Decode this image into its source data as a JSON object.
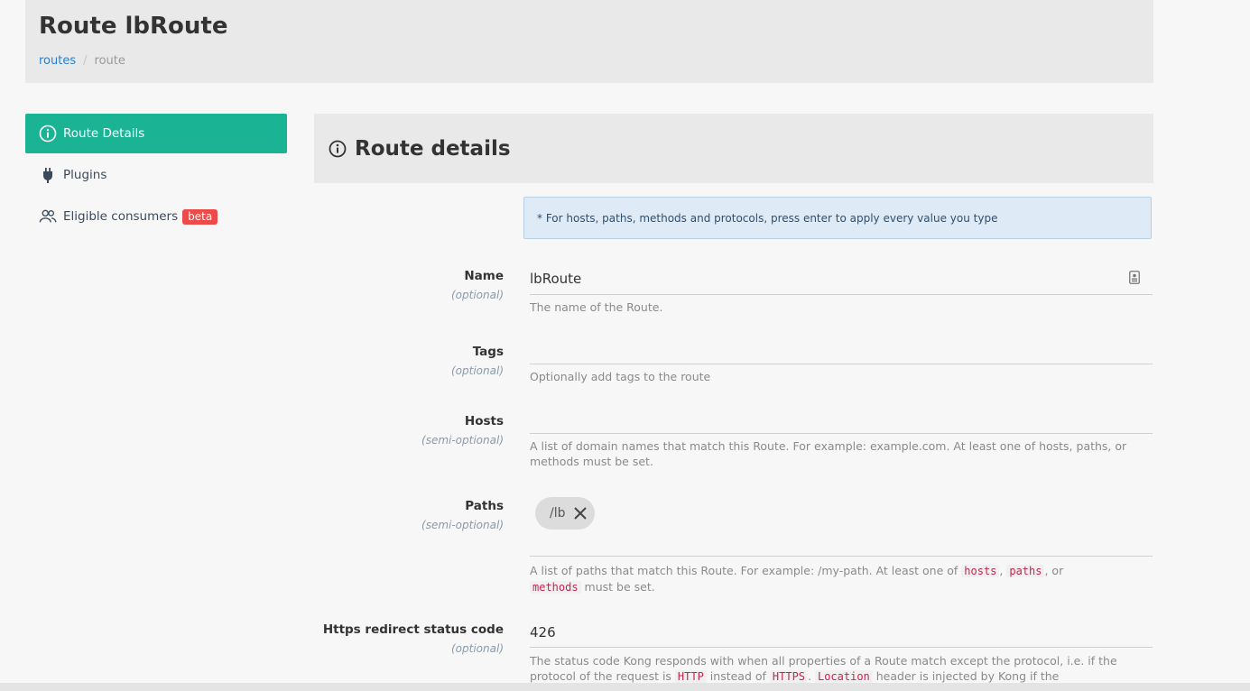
{
  "header": {
    "title": "Route lbRoute",
    "breadcrumb": {
      "link": "routes",
      "separator": "/",
      "current": "route"
    }
  },
  "sidebar": {
    "items": [
      {
        "label": "Route Details",
        "icon": "info-circle-icon",
        "active": true
      },
      {
        "label": "Plugins",
        "icon": "plug-icon",
        "active": false
      },
      {
        "label": "Eligible consumers",
        "icon": "users-icon",
        "badge": "beta",
        "active": false
      }
    ]
  },
  "panel": {
    "title": "Route details",
    "icon": "info-circle-icon"
  },
  "info": "* For hosts, paths, methods and protocols, press enter to apply every value you type",
  "form": {
    "name": {
      "label": "Name",
      "qualifier": "(optional)",
      "value": "lbRoute",
      "help": "The name of the Route."
    },
    "tags": {
      "label": "Tags",
      "qualifier": "(optional)",
      "value": "",
      "help": "Optionally add tags to the route"
    },
    "hosts": {
      "label": "Hosts",
      "qualifier": "(semi-optional)",
      "value": "",
      "help": "A list of domain names that match this Route. For example: example.com. At least one of hosts, paths, or methods must be set."
    },
    "paths": {
      "label": "Paths",
      "qualifier": "(semi-optional)",
      "chips": [
        "/lb"
      ],
      "help_parts": {
        "a": "A list of paths that match this Route. For example: /my-path. At least one of ",
        "code1": "hosts",
        "b": ", ",
        "code2": "paths",
        "c": ", or",
        "code3": "methods",
        "d": " must be set."
      }
    },
    "https_redirect": {
      "label": "Https redirect status code",
      "qualifier": "(optional)",
      "value": "426",
      "help_parts": {
        "a": "The status code Kong responds with when all properties of a Route match except the protocol, i.e. if the protocol of the request is ",
        "code1": "HTTP",
        "b": " instead of ",
        "code2": "HTTPS",
        "c": ". ",
        "code3": "Location",
        "d": " header is injected by Kong if the"
      }
    }
  },
  "colors": {
    "accent": "#1ab394",
    "badge": "#ed4a4a",
    "link": "#2a7fc9",
    "code": "#c7254e"
  }
}
